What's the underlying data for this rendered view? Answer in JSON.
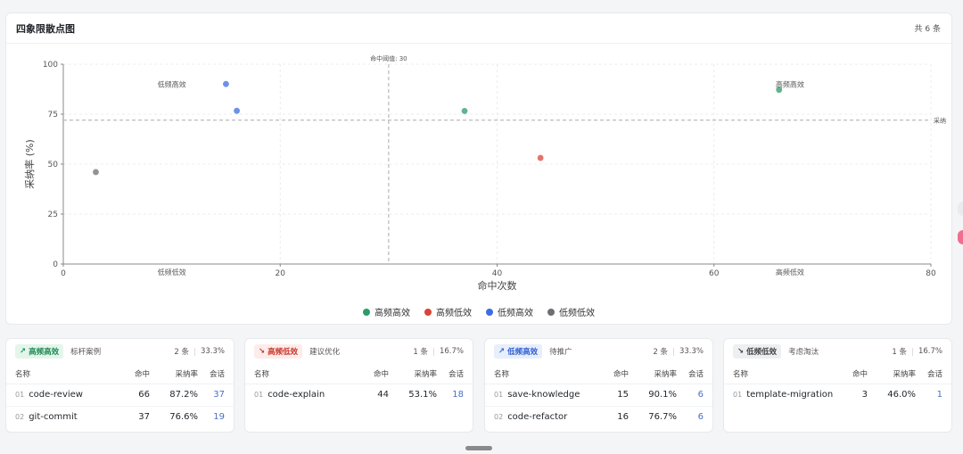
{
  "chart_card": {
    "title": "四象限散点图",
    "count": "共 6 条"
  },
  "chart_data": {
    "type": "scatter",
    "xlabel": "命中次数",
    "ylabel": "采纳率 (%)",
    "xlim": [
      0,
      80
    ],
    "ylim": [
      0,
      100
    ],
    "xticks": [
      "0",
      "20",
      "40",
      "60",
      "80"
    ],
    "yticks": [
      "0",
      "25",
      "50",
      "75",
      "100"
    ],
    "grid": true,
    "legend_position": "bottom",
    "threshold_x": {
      "value": 30,
      "label": "命中阈值: 30"
    },
    "threshold_y": {
      "value": 72,
      "label": "采纳"
    },
    "quadrant_labels": [
      {
        "text": "低频高效",
        "x": 10,
        "y": 90
      },
      {
        "text": "高频高效",
        "x": 67,
        "y": 90
      },
      {
        "text": "低频低效",
        "x": 10,
        "y": 0
      },
      {
        "text": "高频低效",
        "x": 67,
        "y": 0
      }
    ],
    "series": [
      {
        "name": "高频高效",
        "color": "#2e9a6a",
        "points": [
          {
            "x": 66,
            "y": 87.2
          },
          {
            "x": 37,
            "y": 76.6
          }
        ]
      },
      {
        "name": "高频低效",
        "color": "#d9453a",
        "points": [
          {
            "x": 44,
            "y": 53.1
          }
        ]
      },
      {
        "name": "低频高效",
        "color": "#3d6ee0",
        "points": [
          {
            "x": 15,
            "y": 90.1
          },
          {
            "x": 16,
            "y": 76.7
          }
        ]
      },
      {
        "name": "低频低效",
        "color": "#6e6f73",
        "points": [
          {
            "x": 3,
            "y": 46.0
          }
        ]
      }
    ]
  },
  "quadrants": [
    {
      "badge": "高频高效",
      "icon": "trend-up-icon",
      "glyph": "↗",
      "sub": "标杆案例",
      "count": "2 条",
      "pct": "33.3%",
      "badge_bg": "#e4f5ec",
      "badge_fg": "#1f8a55",
      "cols": [
        "名称",
        "命中",
        "采纳率",
        "会话"
      ],
      "rows": [
        {
          "idx": "01",
          "name": "code-review",
          "hits": "66",
          "rate": "87.2%",
          "sessions": "37"
        },
        {
          "idx": "02",
          "name": "git-commit",
          "hits": "37",
          "rate": "76.6%",
          "sessions": "19"
        }
      ]
    },
    {
      "badge": "高频低效",
      "icon": "trend-down-icon",
      "glyph": "↘",
      "sub": "建议优化",
      "count": "1 条",
      "pct": "16.7%",
      "badge_bg": "#fdecea",
      "badge_fg": "#c9372c",
      "cols": [
        "名称",
        "命中",
        "采纳率",
        "会话"
      ],
      "rows": [
        {
          "idx": "01",
          "name": "code-explain",
          "hits": "44",
          "rate": "53.1%",
          "sessions": "18"
        }
      ]
    },
    {
      "badge": "低频高效",
      "icon": "arrow-up-right-icon",
      "glyph": "↗",
      "sub": "待推广",
      "count": "2 条",
      "pct": "33.3%",
      "badge_bg": "#e7eefc",
      "badge_fg": "#2f5fd0",
      "cols": [
        "名称",
        "命中",
        "采纳率",
        "会话"
      ],
      "rows": [
        {
          "idx": "01",
          "name": "save-knowledge",
          "hits": "15",
          "rate": "90.1%",
          "sessions": "6"
        },
        {
          "idx": "02",
          "name": "code-refactor",
          "hits": "16",
          "rate": "76.7%",
          "sessions": "6"
        }
      ]
    },
    {
      "badge": "低频低效",
      "icon": "arrow-down-right-icon",
      "glyph": "↘",
      "sub": "考虑淘汰",
      "count": "1 条",
      "pct": "16.7%",
      "badge_bg": "#eeeff1",
      "badge_fg": "#444",
      "cols": [
        "名称",
        "命中",
        "采纳率",
        "会话"
      ],
      "rows": [
        {
          "idx": "01",
          "name": "template-migration",
          "hits": "3",
          "rate": "46.0%",
          "sessions": "1"
        }
      ]
    }
  ]
}
